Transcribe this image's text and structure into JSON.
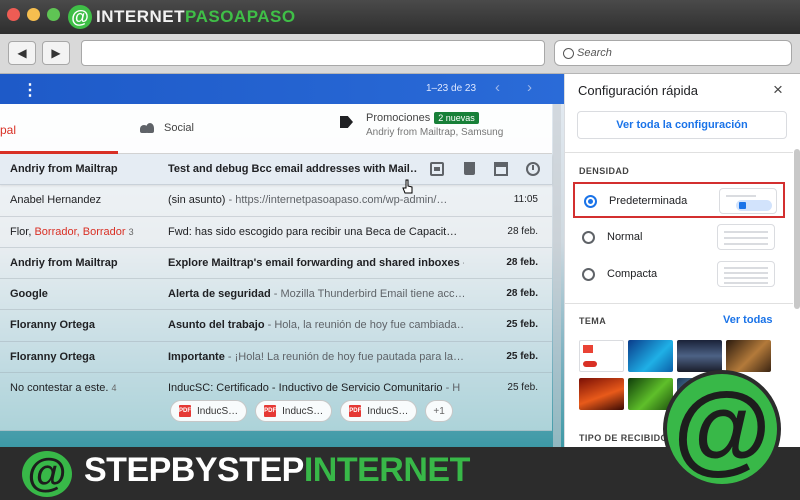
{
  "window": {
    "logo_prefix": "INTERNET",
    "logo_highlight": "PASOAPASO",
    "search_placeholder": "Search"
  },
  "gmail": {
    "pager": "1–23 de 23",
    "tabs": {
      "primary": "pal",
      "social": "Social",
      "promotions": "Promociones",
      "promotions_badge": "2 nuevas",
      "promotions_sub": "Andriy from Mailtrap, Samsung"
    },
    "emails": [
      {
        "sender": "Andriy from Mailtrap",
        "subject": "Test and debug Bcc email addresses with Mail…",
        "snippet": "",
        "date": "",
        "unread": true
      },
      {
        "sender": "Anabel Hernandez",
        "subject": "(sin asunto)",
        "snippet": " - https://internetpasoapaso.com/wp-admin/…",
        "date": "11:05",
        "unread": false
      },
      {
        "sender": "Flor, ",
        "sender_red": "Borrador, Borrador",
        "count": "3",
        "subject": "Fwd: has sido escogido para recibir una Beca de Capacit…",
        "snippet": "",
        "date": "28 feb.",
        "unread": false
      },
      {
        "sender": "Andriy from Mailtrap",
        "subject": "Explore Mailtrap's email forwarding and shared inboxes",
        "snippet": " - M",
        "date": "28 feb.",
        "unread": true
      },
      {
        "sender": "Google",
        "subject": "Alerta de seguridad",
        "snippet": " - Mozilla Thunderbird Email tiene acc…",
        "date": "28 feb.",
        "unread": true
      },
      {
        "sender": "Floranny Ortega",
        "subject": "Asunto del trabajo",
        "snippet": " - Hola, la reunión de hoy fue cambiada…",
        "date": "25 feb.",
        "unread": true
      },
      {
        "sender": "Floranny Ortega",
        "subject": "Importante",
        "snippet": " - ¡Hola! La reunión de hoy fue pautada para la…",
        "date": "25 feb.",
        "unread": true
      },
      {
        "sender": "No contestar a este.",
        "count": "4",
        "subject": "InducSC: Certificado - Inductivo de Servicio Comunitario",
        "snippet": " - H",
        "date": "25 feb.",
        "unread": false
      }
    ],
    "attachments": [
      "InducS…",
      "InducS…",
      "InducS…"
    ],
    "attachments_more": "+1"
  },
  "quick_settings": {
    "title": "Configuración rápida",
    "close": "×",
    "view_all": "Ver toda la configuración",
    "density_title": "DENSIDAD",
    "density_options": [
      {
        "label": "Predeterminada",
        "selected": true
      },
      {
        "label": "Normal",
        "selected": false
      },
      {
        "label": "Compacta",
        "selected": false
      }
    ],
    "theme_title": "TEMA",
    "theme_link": "Ver todas",
    "inbox_type_title": "TIPO DE RECIBIDO"
  },
  "banner": {
    "prefix": "STEPBYSTEP",
    "highlight": "INTERNET"
  },
  "colors": {
    "accent": "#1a73e8",
    "primary_tab": "#d93025",
    "badge": "#188038",
    "brand_green": "#38b848"
  }
}
